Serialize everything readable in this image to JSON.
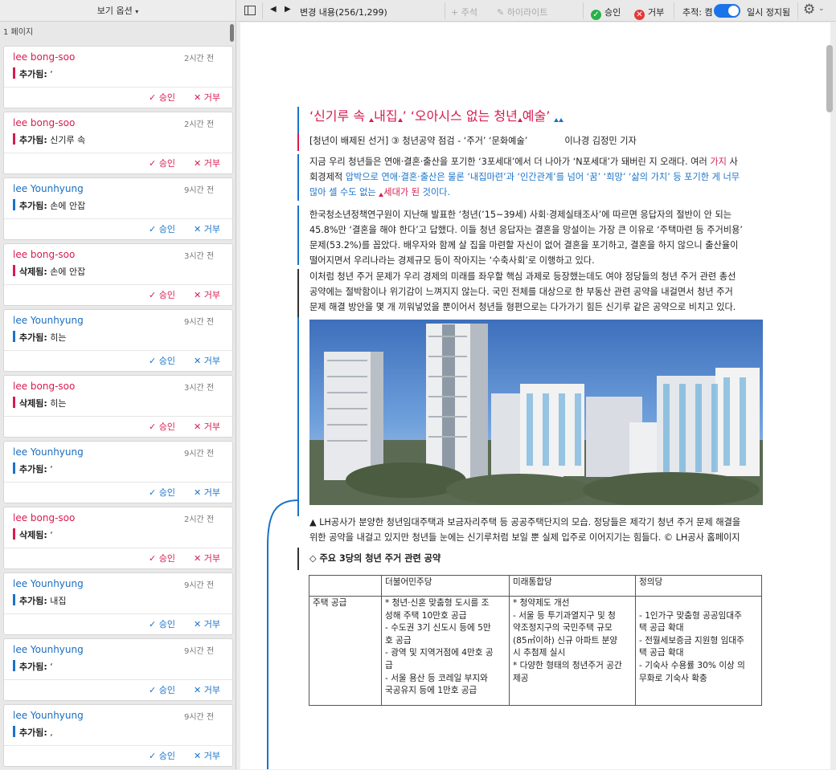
{
  "sidebar": {
    "header": "보기 옵션",
    "page_label": "1 페이지",
    "cards": [
      {
        "user": "lee bong-soo",
        "time": "2시간 전",
        "kind": "추가됨:",
        "text": "‘",
        "accept": "승인",
        "reject": "거부",
        "color": "red"
      },
      {
        "user": "lee bong-soo",
        "time": "2시간 전",
        "kind": "추가됨:",
        "text": "신기루 속",
        "accept": "승인",
        "reject": "거부",
        "color": "red"
      },
      {
        "user": "lee Younhyung",
        "time": "9시간 전",
        "kind": "추가됨:",
        "text": "손에 안잡",
        "accept": "승인",
        "reject": "거부",
        "color": "blue"
      },
      {
        "user": "lee bong-soo",
        "time": "3시간 전",
        "kind": "삭제됨:",
        "text": "손에 안잡",
        "accept": "승인",
        "reject": "거부",
        "color": "red"
      },
      {
        "user": "lee Younhyung",
        "time": "9시간 전",
        "kind": "추가됨:",
        "text": "히는",
        "accept": "승인",
        "reject": "거부",
        "color": "blue"
      },
      {
        "user": "lee bong-soo",
        "time": "3시간 전",
        "kind": "삭제됨:",
        "text": "히는",
        "accept": "승인",
        "reject": "거부",
        "color": "red"
      },
      {
        "user": "lee Younhyung",
        "time": "9시간 전",
        "kind": "추가됨:",
        "text": "‘",
        "accept": "승인",
        "reject": "거부",
        "color": "blue"
      },
      {
        "user": "lee bong-soo",
        "time": "2시간 전",
        "kind": "삭제됨:",
        "text": "‘",
        "accept": "승인",
        "reject": "거부",
        "color": "red"
      },
      {
        "user": "lee Younhyung",
        "time": "9시간 전",
        "kind": "추가됨:",
        "text": "내집",
        "accept": "승인",
        "reject": "거부",
        "color": "blue"
      },
      {
        "user": "lee Younhyung",
        "time": "9시간 전",
        "kind": "추가됨:",
        "text": "‘",
        "accept": "승인",
        "reject": "거부",
        "color": "blue"
      },
      {
        "user": "lee Younhyung",
        "time": "9시간 전",
        "kind": "추가됨:",
        "text": ",",
        "accept": "승인",
        "reject": "거부",
        "color": "blue"
      }
    ]
  },
  "toolbar": {
    "changes": "변경 내용(256/1,299)",
    "comment": "주석",
    "highlight": "하이라이트",
    "accept": "승인",
    "reject": "거부",
    "track": "추적: 켬",
    "pause": "일시 정지됨"
  },
  "doc": {
    "title_a": "‘신기루 속 ",
    "title_b": "내집",
    "title_c": "’ ‘오아시스 없는 청년",
    "title_d": "예술",
    "title_e": "’",
    "sub_a": "[청년이  배제된 선거] ③ 청년공약 점검 - ‘주거’ ‘문화예술’",
    "sub_b": "이나경 김정민 기자",
    "p1_a": "지금 우리 청년들은 연애·결혼·출산을 포기한 ‘3포세대’에서 더 나아가 ‘N포세대’가 돼버린 지 오래다. 여러 ",
    "p1_b": "가지",
    "p1_c": " 사",
    "p1_d": "회경제적 ",
    "p1_e": "압박으로 연애·결혼·출산은 물론 ‘내집마련’과 ‘인간관계’를 넘어 ‘꿈’ ‘희망’ ‘삶의 가치’ 등 포기한 게 너무",
    "p1_f": "많아 셀 수도 없는 ",
    "p1_g": "세대가 ",
    "p1_h": "된",
    "p1_i": " 것이다.",
    "p2_1": "한국청소년정책연구원이 지난해 발표한 ‘청년(’15~39세) 사회·경제실태조사’에 따르면 응답자의 절반이 안 되는",
    "p2_2": "45.8%만 ‘결혼을 해야 한다’고 답했다. 이들 청년 응답자는 결혼을 망설이는 가장 큰 이유로 ‘주택마련 등 주거비용’",
    "p2_3": "문제(53.2%)를 꼽았다. 배우자와 함께 살 집을 마련할 자신이 없어 결혼을 포기하고, 결혼을 하지 않으니 출산율이",
    "p2_4": "떨어지면서 우리나라는 경제규모 등이 작아지는 ‘수축사회’로 이행하고 있다.",
    "p3_1": "이처럼 청년 주거 문제가 우리 경제의 미래를 좌우할 핵심 과제로 등장했는데도 여야 정당들의 청년 주거 관련 총선",
    "p3_2": "공약에는 절박함이나 위기감이 느껴지지 않는다. 국민 전체를 대상으로 한 부동산 관련 공약을 내걸면서 청년 주거",
    "p3_3": "문제 해결 방안을 몇 개 끼워넣었을 뿐이어서 청년들 형편으로는 다가가기 힘든 신기루 같은 공약으로 비치고 있다.",
    "cap_1": "▲ LH공사가 분양한 청년임대주택과 보금자리주택 등 공공주택단지의 모습. 정당들은 제각기 청년 주거 문제 해결을",
    "cap_2": "위한 공약을 내걸고 있지만 청년들 눈에는 신기루처럼 보일 뿐 실제 입주로 이어지기는 힘들다. © LH공사 홈페이지",
    "section": "◇ 주요 3당의 청년 주거 관련 공약",
    "table": {
      "headers": [
        "",
        "더불어민주당",
        "미래통합당",
        "정의당"
      ],
      "row_label": "주택 공급",
      "col1": [
        "* 청년·신혼 맞춤형 도시를 조",
        "성해 주택 10만호 공급",
        "- 수도권 3기 신도시 등에 5만",
        "호 공급",
        "- 광역 및 지역거점에 4만호 공",
        "급",
        "- 서울 용산 등 코레일 부지와",
        "국공유지 등에 1만호 공급"
      ],
      "col2": [
        "* 청약제도 개선",
        "- 서울 등 투기과열지구 및 청",
        "약조정지구의 국민주택 규모",
        "(85㎡이하) 신규 아파트 분양",
        "시 추첨제 실시",
        "* 다양한 형태의 청년주거 공간",
        "제공"
      ],
      "col3": [
        "",
        "- 1인가구 맞춤형 공공임대주",
        "택 공급 확대",
        "- 전월세보증금 지원형 임대주",
        "택 공급 확대",
        "- 기숙사 수용률 30% 이상 의",
        "무화로 기숙사 확충"
      ]
    }
  },
  "colors": {
    "accent_red": "#d81b50",
    "accent_blue": "#1a73c9",
    "toggle": "#1a73e8",
    "accept_green": "#29b14b",
    "reject_red": "#e53935"
  }
}
